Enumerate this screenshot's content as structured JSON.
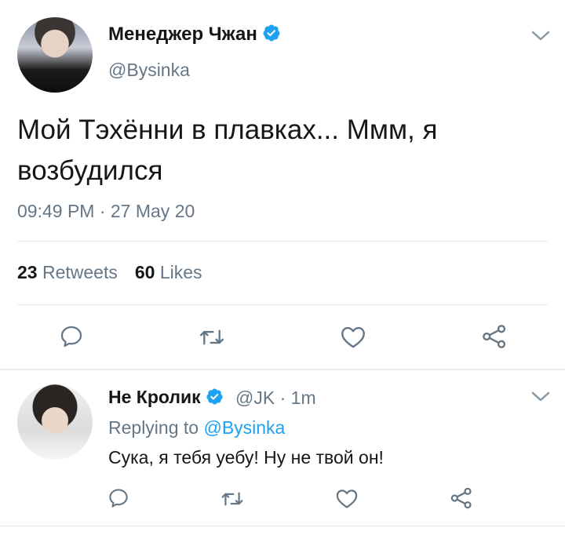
{
  "tweet": {
    "author_name": "Менеджер Чжан",
    "author_handle": "@Bysinka",
    "text": "Мой Тэхённи в плавках... Ммм, я возбудился",
    "timestamp": "09:49 PM · 27 May 20",
    "retweets_count": "23",
    "retweets_label": "Retweets",
    "likes_count": "60",
    "likes_label": "Likes"
  },
  "reply": {
    "author_name": "Не Кролик",
    "author_handle": "@JK",
    "separator": "·",
    "time_ago": "1m",
    "replying_prefix": "Replying to",
    "replying_to": "@Bysinka",
    "text": "Сука, я тебя уебу! Ну не твой он!"
  },
  "icons": [
    "verified-badge-icon",
    "chevron-down-icon",
    "reply-icon",
    "retweet-icon",
    "like-icon",
    "share-icon"
  ],
  "colors": {
    "accent": "#1da1f2",
    "secondary_text": "#657786",
    "icon_gray": "#657786",
    "divider": "#e1e8ed"
  }
}
